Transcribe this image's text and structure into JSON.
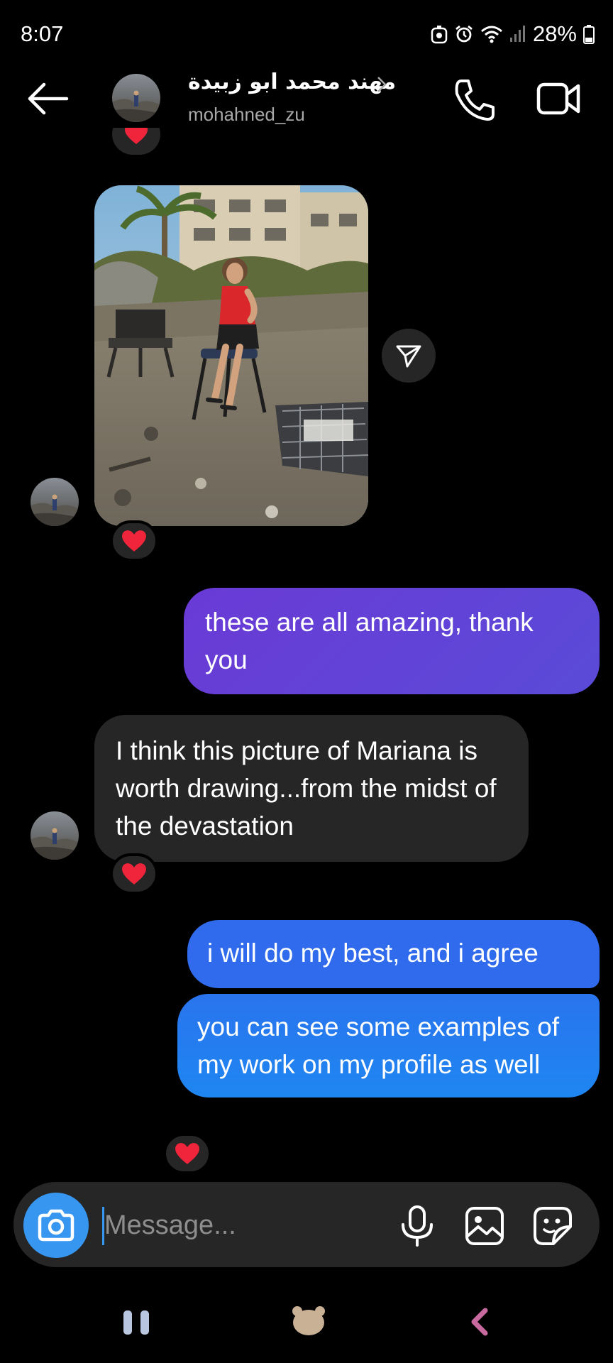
{
  "status_bar": {
    "time": "8:07",
    "battery": "28%"
  },
  "header": {
    "contact_name": "مهند محمد ابو زبيدة",
    "username": "mohahned_zu"
  },
  "messages": [
    {
      "type": "photo",
      "from": "contact",
      "reaction": "❤️",
      "description_icon": "photo-message"
    },
    {
      "type": "text",
      "from": "me",
      "text": "these are all amazing, thank you"
    },
    {
      "type": "text",
      "from": "contact",
      "text": "I think this picture of Mariana is worth drawing...from the midst of the devastation",
      "reaction": "❤️"
    },
    {
      "type": "text",
      "from": "me",
      "text": "i will do my best, and i agree"
    },
    {
      "type": "text",
      "from": "me",
      "text": "you can see some examples of my work on my profile as well",
      "reaction": "❤️"
    }
  ],
  "composer": {
    "placeholder": "Message..."
  },
  "colors": {
    "background": "#000000",
    "incoming_bubble": "#262626",
    "outgoing_purple": "#6a3ad6",
    "outgoing_blue": "#2f6bec",
    "accent": "#3797f0",
    "secondary_text": "#a8a8a8"
  }
}
